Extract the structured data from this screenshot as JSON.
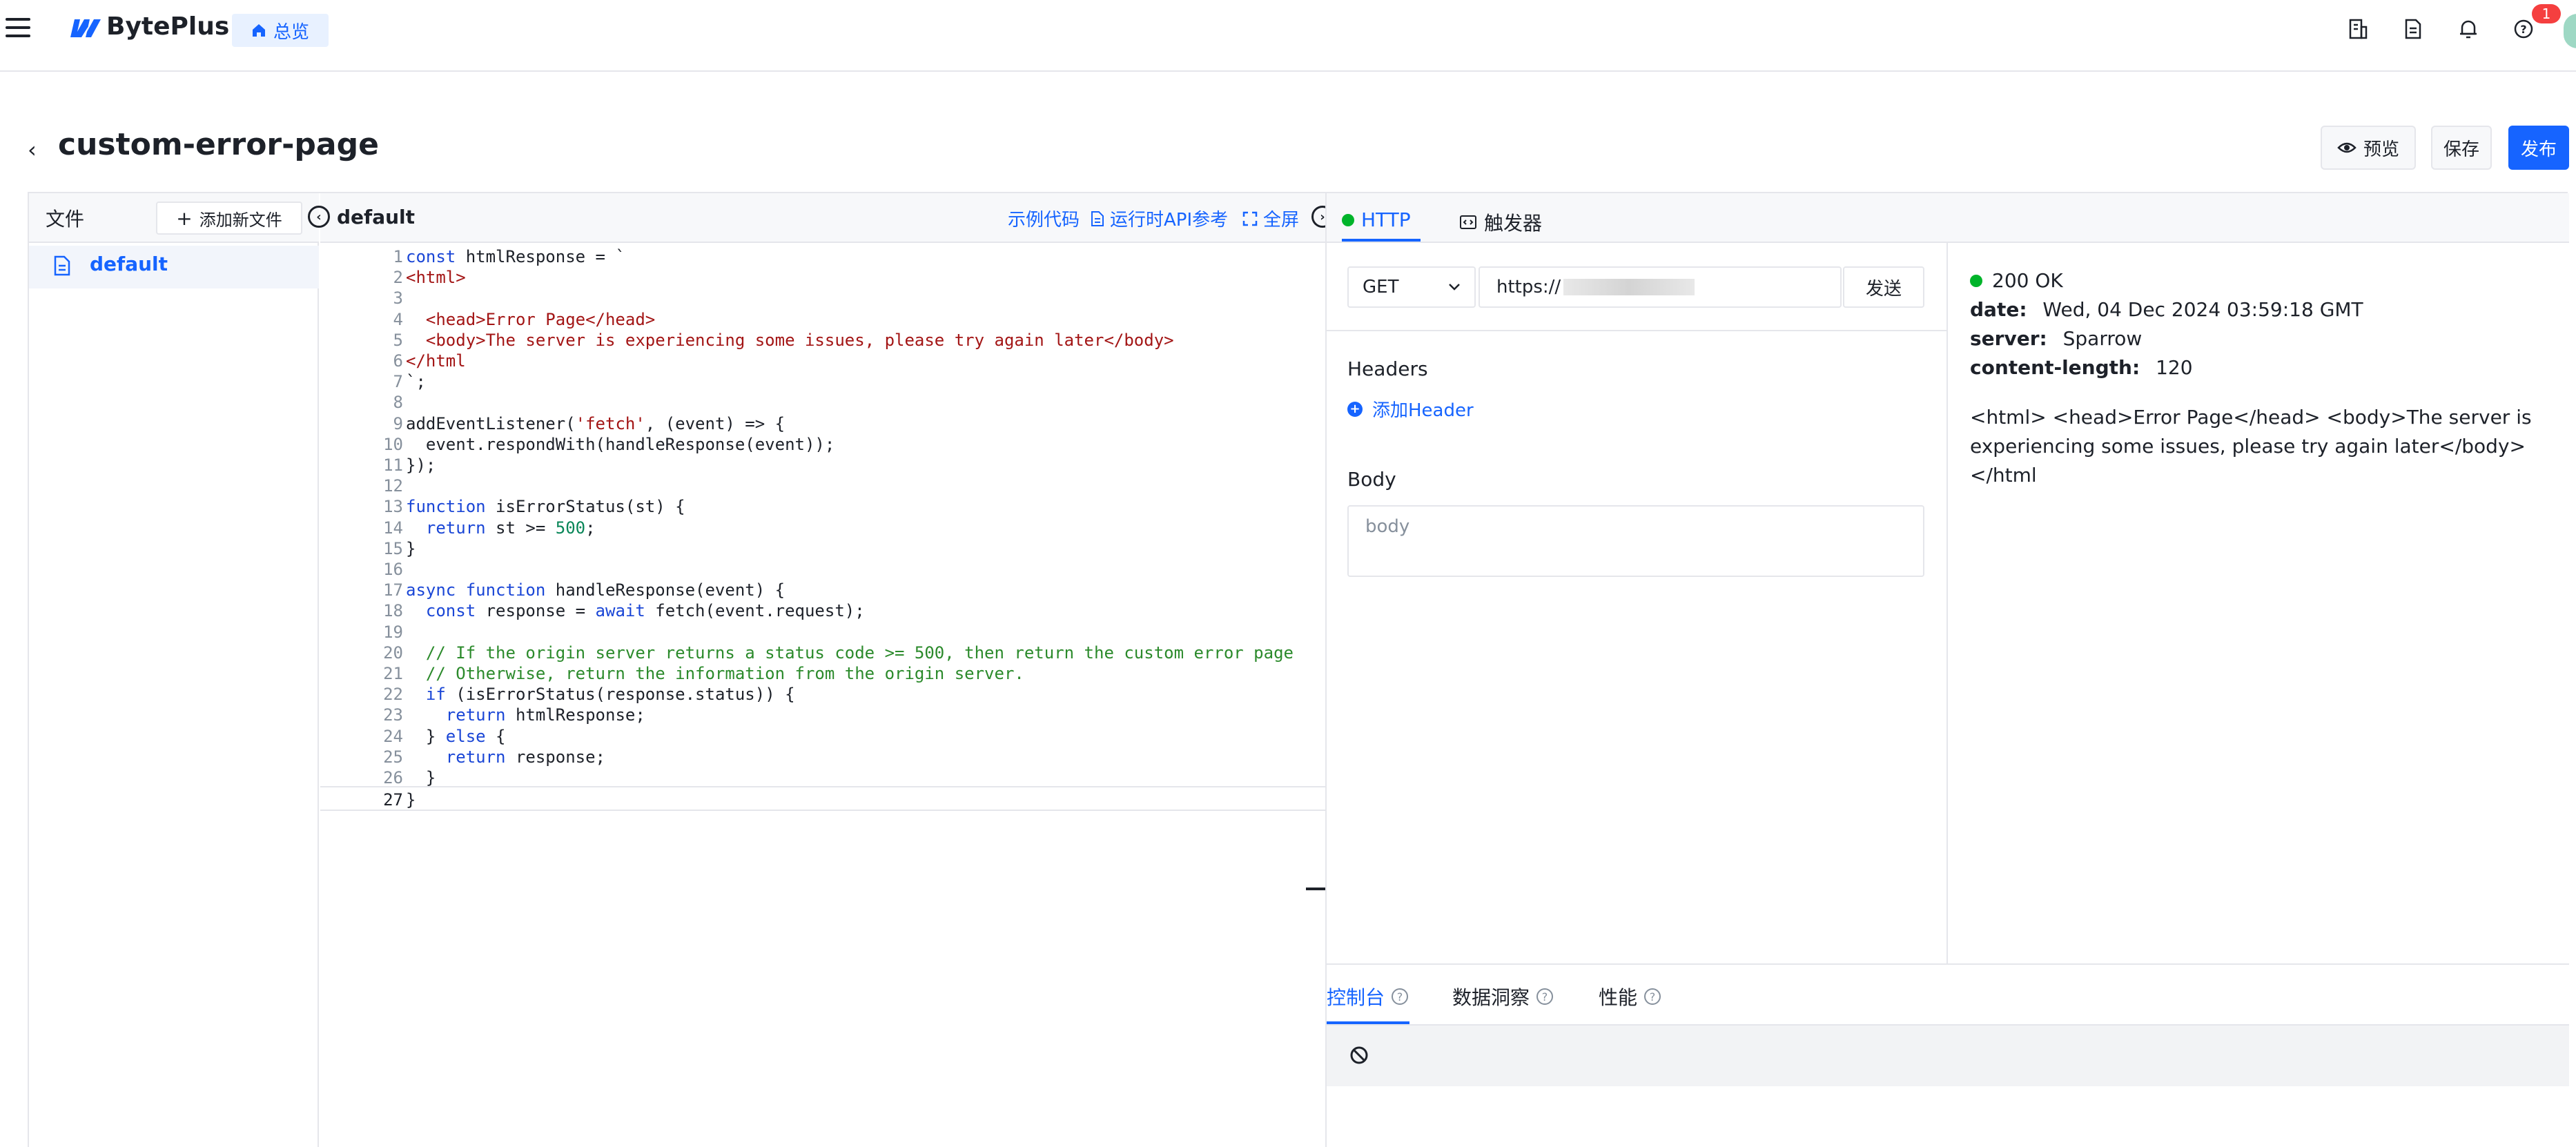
{
  "brand": {
    "name": "BytePlus",
    "accent": "#1664ff"
  },
  "topbar": {
    "overview_label": "总览",
    "icons": [
      "building-icon",
      "document-icon",
      "bell-icon",
      "help-icon"
    ],
    "notification_count": "1"
  },
  "page": {
    "title": "custom-error-page",
    "buttons": {
      "preview": "预览",
      "save": "保存",
      "publish": "发布"
    }
  },
  "files": {
    "title": "文件",
    "add_label": "添加新文件",
    "items": [
      {
        "name": "default"
      }
    ]
  },
  "editor": {
    "tab_title": "default",
    "links": {
      "examples": "示例代码",
      "api_ref": "运行时API参考",
      "fullscreen": "全屏"
    },
    "current_line": 27,
    "lines": [
      "const htmlResponse = `",
      "<html>",
      "",
      "  <head>Error Page</head>",
      "  <body>The server is experiencing some issues, please try again later</body>",
      "</html",
      "`;",
      "",
      "addEventListener('fetch', (event) => {",
      "  event.respondWith(handleResponse(event));",
      "});",
      "",
      "function isErrorStatus(st) {",
      "  return st >= 500;",
      "}",
      "",
      "async function handleResponse(event) {",
      "  const response = await fetch(event.request);",
      "",
      "  // If the origin server returns a status code >= 500, then return the custom error page",
      "  // Otherwise, return the information from the origin server.",
      "  if (isErrorStatus(response.status)) {",
      "    return htmlResponse;",
      "  } else {",
      "    return response;",
      "  }",
      "}"
    ]
  },
  "tester": {
    "tabs": {
      "http": "HTTP",
      "trigger": "触发器"
    },
    "request": {
      "method": "GET",
      "url": "https://",
      "send_label": "发送",
      "headers_title": "Headers",
      "add_header_label": "添加Header",
      "body_title": "Body",
      "body_placeholder": "body"
    },
    "response": {
      "status": "200 OK",
      "status_color": "#00b42a",
      "headers": [
        {
          "key": "date:",
          "value": "Wed, 04 Dec 2024 03:59:18 GMT"
        },
        {
          "key": "server:",
          "value": "Sparrow"
        },
        {
          "key": "content-length:",
          "value": "120"
        }
      ],
      "body": "<html> <head>Error Page</head> <body>The server is experiencing some issues, please try again later</body> </html"
    }
  },
  "console": {
    "tabs": [
      "控制台",
      "数据洞察",
      "性能"
    ],
    "active_tab": "控制台"
  }
}
